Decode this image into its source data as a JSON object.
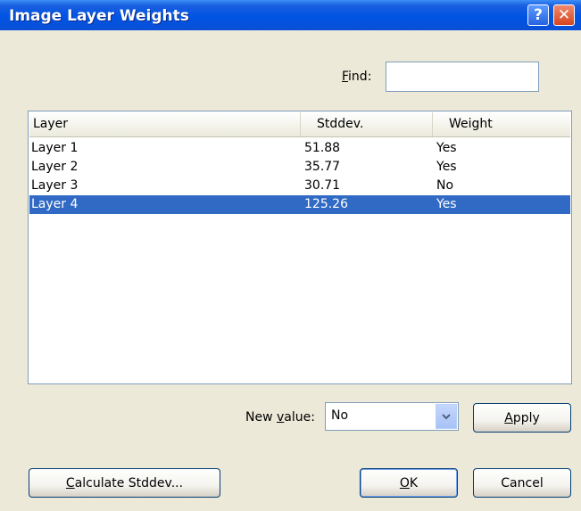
{
  "window": {
    "title": "Image Layer Weights",
    "help_label": "?",
    "close_label": "✕"
  },
  "find": {
    "label_accel": "F",
    "label_rest": "ind:",
    "value": ""
  },
  "table": {
    "columns": [
      "Layer",
      "Stddev.",
      "Weight"
    ],
    "rows": [
      {
        "layer": "Layer 1",
        "stddev": "51.88",
        "weight": "Yes",
        "selected": false
      },
      {
        "layer": "Layer 2",
        "stddev": "35.77",
        "weight": "Yes",
        "selected": false
      },
      {
        "layer": "Layer 3",
        "stddev": "30.71",
        "weight": "No",
        "selected": false
      },
      {
        "layer": "Layer 4",
        "stddev": "125.26",
        "weight": "Yes",
        "selected": true
      }
    ]
  },
  "new_value": {
    "label_pre": "New ",
    "label_accel": "v",
    "label_post": "alue:",
    "selected": "No"
  },
  "buttons": {
    "apply_accel": "A",
    "apply_rest": "pply",
    "calc_accel": "C",
    "calc_rest": "alculate Stddev...",
    "ok_accel": "O",
    "ok_rest": "K",
    "cancel": "Cancel"
  },
  "colors": {
    "titlebar": "#0054e3",
    "selection": "#316ac5",
    "dialog_bg": "#ece9d8"
  },
  "icons": {
    "help": "help-icon",
    "close": "close-icon",
    "dropdown": "chevron-down-icon"
  }
}
